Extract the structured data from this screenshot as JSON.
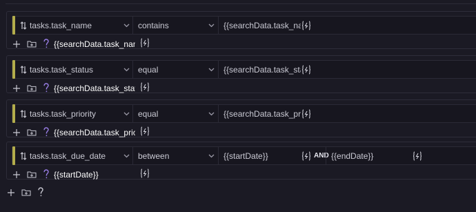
{
  "conditions": [
    {
      "field": "tasks.task_name",
      "operator": "equal_placeholder",
      "op_label": "contains",
      "value": "{{searchData.task_name}}",
      "binding": "{{searchData.task_name}}"
    },
    {
      "field": "tasks.task_status",
      "op_label": "equal",
      "value": "{{searchData.task_status}}",
      "binding": "{{searchData.task_status}}"
    },
    {
      "field": "tasks.task_priority",
      "op_label": "equal",
      "value": "{{searchData.task_priority}}",
      "binding": "{{searchData.task_priority}}"
    },
    {
      "field": "tasks.task_due_date",
      "op_label": "between",
      "value": "{{startDate}}",
      "and_label": "AND",
      "value2": "{{endDate}}",
      "binding": "{{startDate}}"
    }
  ],
  "colors": {
    "accent_bar": "#b3ad4b",
    "help_icon": "#9a7fe6",
    "background": "#1b1a24"
  },
  "icons": [
    "sort-icon",
    "chevron-down-icon",
    "function-icon",
    "plus-icon",
    "add-group-icon",
    "help-icon"
  ]
}
